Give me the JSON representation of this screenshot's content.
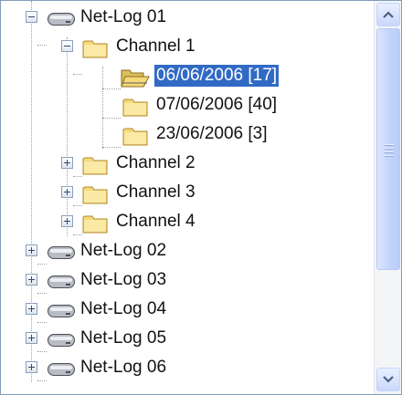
{
  "tree": {
    "nodes": [
      {
        "id": "netlog01",
        "label": "Net-Log 01",
        "icon": "device-icon",
        "expanded": true
      },
      {
        "id": "channel1",
        "label": "Channel 1",
        "icon": "folder-icon",
        "expanded": true
      },
      {
        "id": "date1",
        "label": "06/06/2006  [17]",
        "icon": "folder-open-icon",
        "selected": true
      },
      {
        "id": "date2",
        "label": "07/06/2006  [40]",
        "icon": "folder-icon"
      },
      {
        "id": "date3",
        "label": "23/06/2006  [3]",
        "icon": "folder-icon"
      },
      {
        "id": "channel2",
        "label": "Channel 2",
        "icon": "folder-icon",
        "expanded": false
      },
      {
        "id": "channel3",
        "label": "Channel 3",
        "icon": "folder-icon",
        "expanded": false
      },
      {
        "id": "channel4",
        "label": "Channel 4",
        "icon": "folder-icon",
        "expanded": false
      },
      {
        "id": "netlog02",
        "label": "Net-Log 02",
        "icon": "device-icon",
        "expanded": false
      },
      {
        "id": "netlog03",
        "label": "Net-Log 03",
        "icon": "device-icon",
        "expanded": false
      },
      {
        "id": "netlog04",
        "label": "Net-Log 04",
        "icon": "device-icon",
        "expanded": false
      },
      {
        "id": "netlog05",
        "label": "Net-Log 05",
        "icon": "device-icon",
        "expanded": false
      },
      {
        "id": "netlog06",
        "label": "Net-Log 06",
        "icon": "device-icon",
        "expanded": false
      }
    ]
  },
  "scrollbar": {
    "up_icon": "arrow-up-icon",
    "down_icon": "arrow-down-icon"
  },
  "colors": {
    "selection": "#316ac5",
    "folder": "#f5d97a",
    "device": "#b8bcc4"
  }
}
